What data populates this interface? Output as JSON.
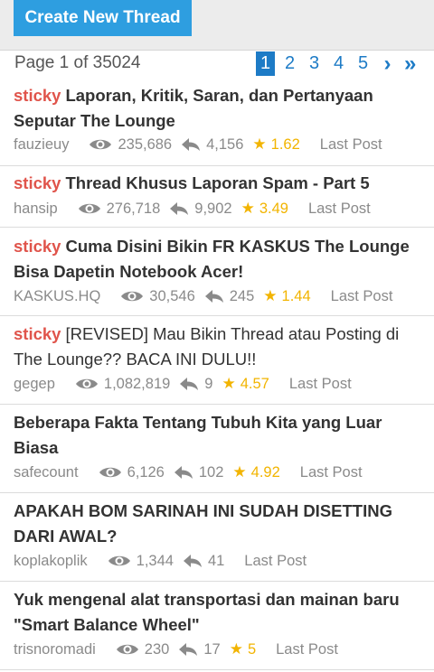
{
  "toolbar": {
    "create_label": "Create New Thread"
  },
  "pagination": {
    "info": "Page 1 of 35024",
    "pages": [
      "1",
      "2",
      "3",
      "4",
      "5"
    ],
    "next": "›",
    "last": "»"
  },
  "threads": [
    {
      "sticky": "sticky",
      "title": "Laporan, Kritik, Saran, dan Pertanyaan Seputar The Lounge",
      "author": "fauzieuy",
      "views": "235,686",
      "replies": "4,156",
      "rating": "1.62",
      "last_post": "Last Post"
    },
    {
      "sticky": "sticky",
      "title": "Thread Khusus Laporan Spam - Part 5",
      "author": "hansip",
      "views": "276,718",
      "replies": "9,902",
      "rating": "3.49",
      "last_post": "Last Post"
    },
    {
      "sticky": "sticky",
      "title": "Cuma Disini Bikin FR KASKUS The Lounge Bisa Dapetin Notebook Acer!",
      "author": "KASKUS.HQ",
      "views": "30,546",
      "replies": "245",
      "rating": "1.44",
      "last_post": "Last Post"
    },
    {
      "sticky": "sticky",
      "title": "[REVISED] Mau Bikin Thread atau Posting di The Lounge?? BACA INI DULU!!",
      "author": "gegep",
      "views": "1,082,819",
      "replies": "9",
      "rating": "4.57",
      "last_post": "Last Post"
    },
    {
      "sticky": "",
      "title": "Beberapa Fakta Tentang Tubuh Kita yang Luar Biasa",
      "author": "safecount",
      "views": "6,126",
      "replies": "102",
      "rating": "4.92",
      "last_post": "Last Post"
    },
    {
      "sticky": "",
      "title": "APAKAH BOM SARINAH INI SUDAH DISETTING DARI AWAL?",
      "author": "koplakoplik",
      "views": "1,344",
      "replies": "41",
      "rating": "",
      "last_post": "Last Post"
    },
    {
      "sticky": "",
      "title": "Yuk mengenal alat transportasi dan mainan baru \"Smart Balance Wheel\"",
      "author": "trisnoromadi",
      "views": "230",
      "replies": "17",
      "rating": "5",
      "last_post": "Last Post"
    }
  ],
  "colors": {
    "accent": "#2e9ee0",
    "sticky": "#e0544b",
    "star": "#f2b400",
    "link": "#1d7bc6"
  },
  "icons": {
    "views": "eye-icon",
    "replies": "reply-arrow-icon",
    "rating": "star-icon"
  }
}
